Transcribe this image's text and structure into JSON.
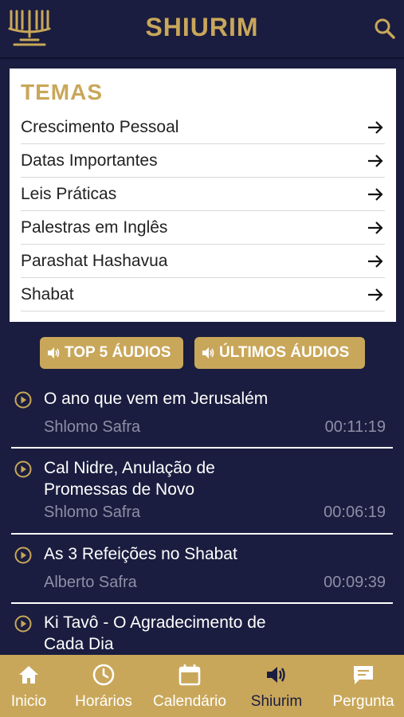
{
  "header": {
    "title": "SHIURIM",
    "logo_icon": "menorah-icon",
    "search_icon": "search-icon"
  },
  "temas": {
    "title": "TEMAS",
    "items": [
      {
        "label": "Crescimento Pessoal"
      },
      {
        "label": "Datas Importantes"
      },
      {
        "label": "Leis Práticas"
      },
      {
        "label": "Palestras em Inglês"
      },
      {
        "label": "Parashat Hashavua"
      },
      {
        "label": "Shabat"
      }
    ]
  },
  "tabs": [
    {
      "label": "TOP 5 ÁUDIOS",
      "icon": "speaker-icon"
    },
    {
      "label": "ÚLTIMOS ÁUDIOS",
      "icon": "speaker-icon"
    }
  ],
  "audios": [
    {
      "title": "O ano que vem em Jerusalém",
      "author": "Shlomo Safra",
      "duration": "00:11:19"
    },
    {
      "title": "Cal Nidre, Anulação de Promessas de Novo",
      "author": "Shlomo Safra",
      "duration": "00:06:19"
    },
    {
      "title": "As 3 Refeições no Shabat",
      "author": "Alberto Safra",
      "duration": "00:09:39"
    },
    {
      "title": "Ki Tavô - O Agradecimento de Cada Dia",
      "author": "",
      "duration": ""
    }
  ],
  "nav": [
    {
      "label": "Inicio",
      "icon": "home-icon"
    },
    {
      "label": "Horários",
      "icon": "clock-icon"
    },
    {
      "label": "Calendário",
      "icon": "calendar-icon"
    },
    {
      "label": "Shiurim",
      "icon": "speaker-icon",
      "active": true
    },
    {
      "label": "Pergunta",
      "icon": "chat-icon"
    }
  ],
  "colors": {
    "navy": "#1a1d3f",
    "gold": "#c9a75a",
    "white": "#ffffff",
    "muted": "#8d8fa6"
  }
}
